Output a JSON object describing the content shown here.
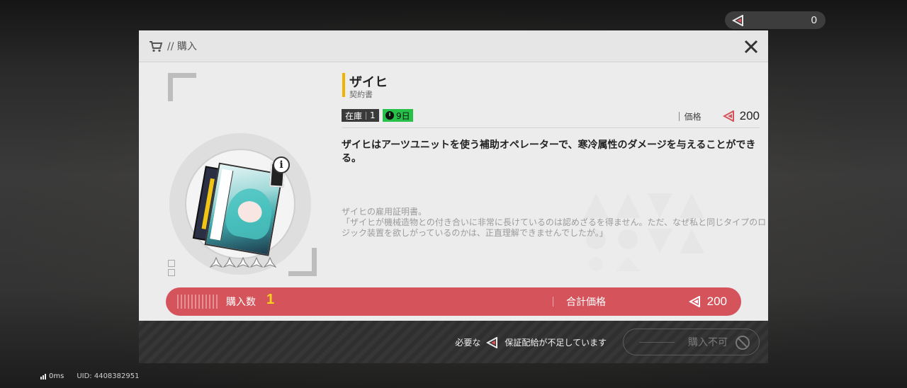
{
  "topbar": {
    "currency_amount": "0"
  },
  "header": {
    "title": "// 購入"
  },
  "item": {
    "name": "ザイヒ",
    "type": "契約書",
    "stock_label": "在庫",
    "stock_value": "1",
    "timer": "9日",
    "rarity": 5,
    "price_label": "価格",
    "price_value": "200",
    "description": "ザイヒはアーツユニットを使う補助オペレーターで、寒冷属性のダメージを与えることができる。",
    "lore_line1": "ザイヒの雇用証明書。",
    "lore_line2": "「ザイヒが機械造物との付き合いに非常に長けているのは認めざるを得ません。ただ、なぜ私と同じタイプのロジック装置を欲しがっているのかは、正直理解できませんでしたが。」"
  },
  "purchase": {
    "qty_label": "購入数",
    "qty_value": "1",
    "total_label": "合計価格",
    "total_value": "200"
  },
  "footer": {
    "need_prefix": "必要な",
    "need_suffix": "保証配給が不足しています",
    "button_label": "購入不可"
  },
  "status": {
    "ping": "0ms",
    "uid": "UID: 4408382951"
  },
  "colors": {
    "accent_red": "#d5545c",
    "timer_green": "#27c14a",
    "name_bar": "#f0b400",
    "qty_yellow": "#ffd21a"
  }
}
